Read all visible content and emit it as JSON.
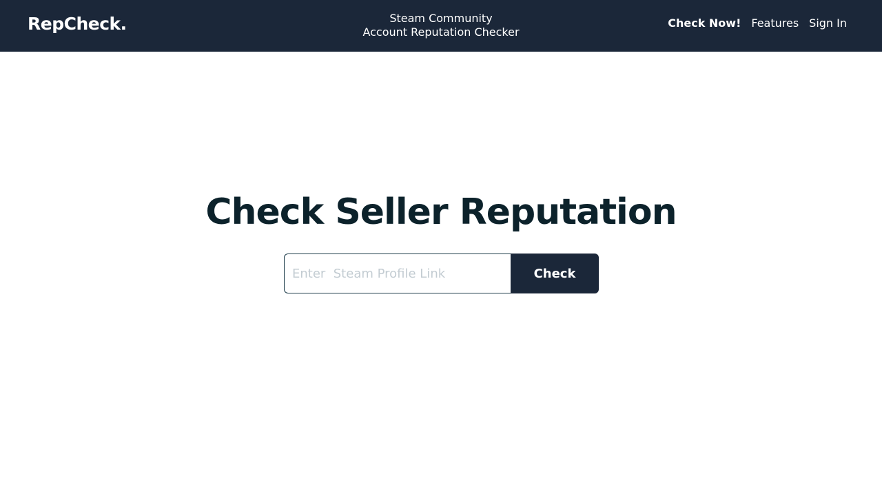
{
  "header": {
    "logo": "RepCheck.",
    "tagline_line1": "Steam Community",
    "tagline_line2": "Account Reputation Checker",
    "nav": {
      "check_now": "Check Now!",
      "features": "Features",
      "sign_in": "Sign In"
    }
  },
  "hero": {
    "title": "Check Seller Reputation",
    "search_placeholder": "Enter  Steam Profile Link",
    "search_value": "",
    "button_label": "Check"
  },
  "colors": {
    "navbar_bg": "#1b2739",
    "title_text": "#0c222b",
    "button_bg": "#1b2739",
    "input_border": "#1b3a48",
    "placeholder": "#c3ccd2"
  }
}
